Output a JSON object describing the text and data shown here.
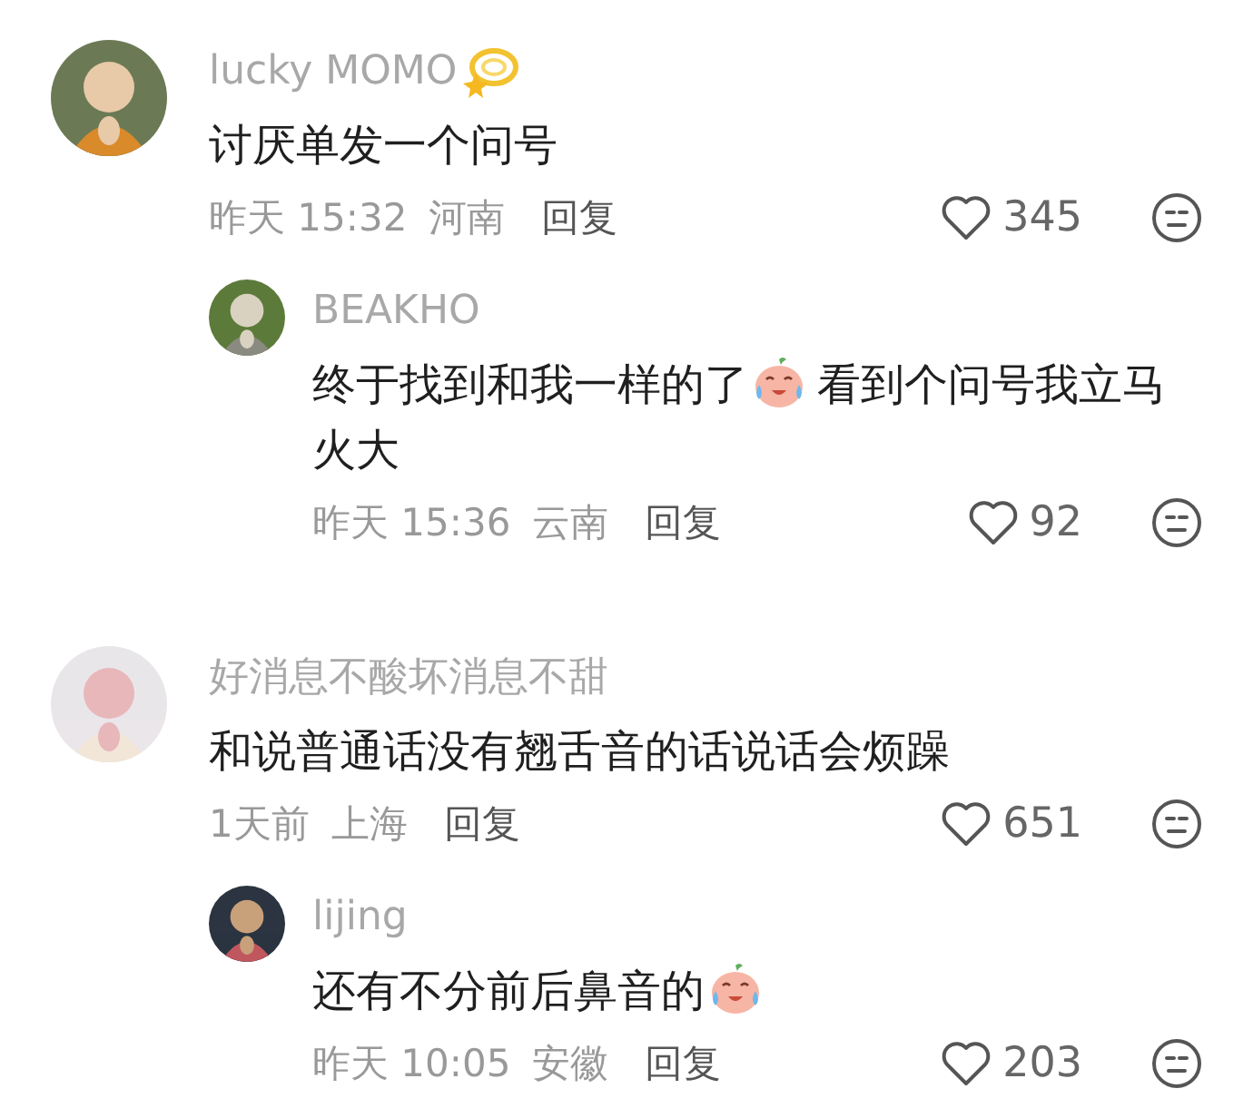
{
  "comments": [
    {
      "user": "lucky MOMO",
      "name_badge": true,
      "parts": [
        {
          "kind": "text",
          "text": "讨厌单发一个问号"
        }
      ],
      "time": "昨天 15:32",
      "location": "河南",
      "reply_label": "回复",
      "likes": "345",
      "replies": [
        {
          "user": "BEAKHO",
          "name_badge": false,
          "parts": [
            {
              "kind": "text",
              "text": "终于找到和我一样的了"
            },
            {
              "kind": "emoji"
            },
            {
              "kind": "text",
              "text": "看到个问号我立马"
            },
            {
              "kind": "text",
              "text": "火大"
            }
          ],
          "time": "昨天 15:36",
          "location": "云南",
          "reply_label": "回复",
          "likes": "92"
        }
      ]
    },
    {
      "user": "好消息不酸坏消息不甜",
      "name_badge": false,
      "parts": [
        {
          "kind": "text",
          "text": "和说普通话没有翘舌音的话说话会烦躁"
        }
      ],
      "time": "1天前",
      "location": "上海",
      "reply_label": "回复",
      "likes": "651",
      "replies": [
        {
          "user": "lijing",
          "name_badge": false,
          "parts": [
            {
              "kind": "text",
              "text": "还有不分前后鼻音的"
            },
            {
              "kind": "emoji"
            }
          ],
          "time": "昨天 10:05",
          "location": "安徽",
          "reply_label": "回复",
          "likes": "203"
        }
      ]
    }
  ]
}
